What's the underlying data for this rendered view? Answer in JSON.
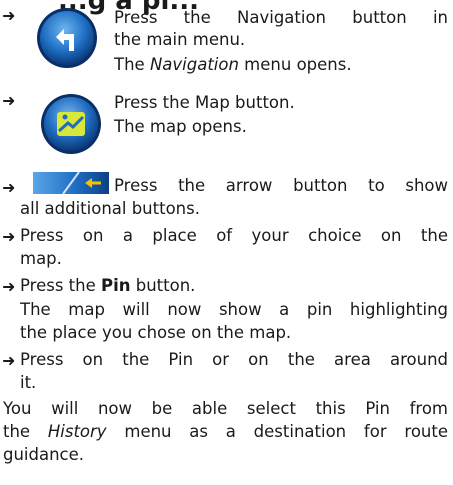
{
  "heading": "...g a pi...",
  "steps": {
    "s1": {
      "action": "Press the Navigation button in",
      "action_cont": "the main menu.",
      "result_pre": "The ",
      "result_em": "Navigation",
      "result_post": " menu opens."
    },
    "s2": {
      "action": "Press the Map button.",
      "result": "The map opens."
    },
    "s3": {
      "action": "Press the arrow button to show",
      "action_cont": "all additional buttons."
    },
    "s4": {
      "line1": "Press on a place of your choice on the",
      "line2": "map."
    },
    "s5": {
      "pre": "Press the ",
      "bold": "Pin",
      "post": " button.",
      "result1": "The map will now show a pin highlighting",
      "result2": "the place you chose on the map."
    },
    "s6": {
      "line1": "Press on the Pin or on the area around",
      "line2": "it."
    }
  },
  "closing": {
    "line1": "You will now be able select this Pin from",
    "line2_pre": "the ",
    "line2_em": "History",
    "line2_post": " menu as a destination for route",
    "line3": "guidance."
  },
  "arrow_glyph": "➜",
  "icons": {
    "navigation": "navigation-button-icon",
    "map": "map-button-icon",
    "arrow": "arrow-left-button-icon"
  },
  "colors": {
    "accent_blue": "#1f6fc4",
    "dark_blue": "#0d3f86",
    "text": "#1a1a1a"
  }
}
